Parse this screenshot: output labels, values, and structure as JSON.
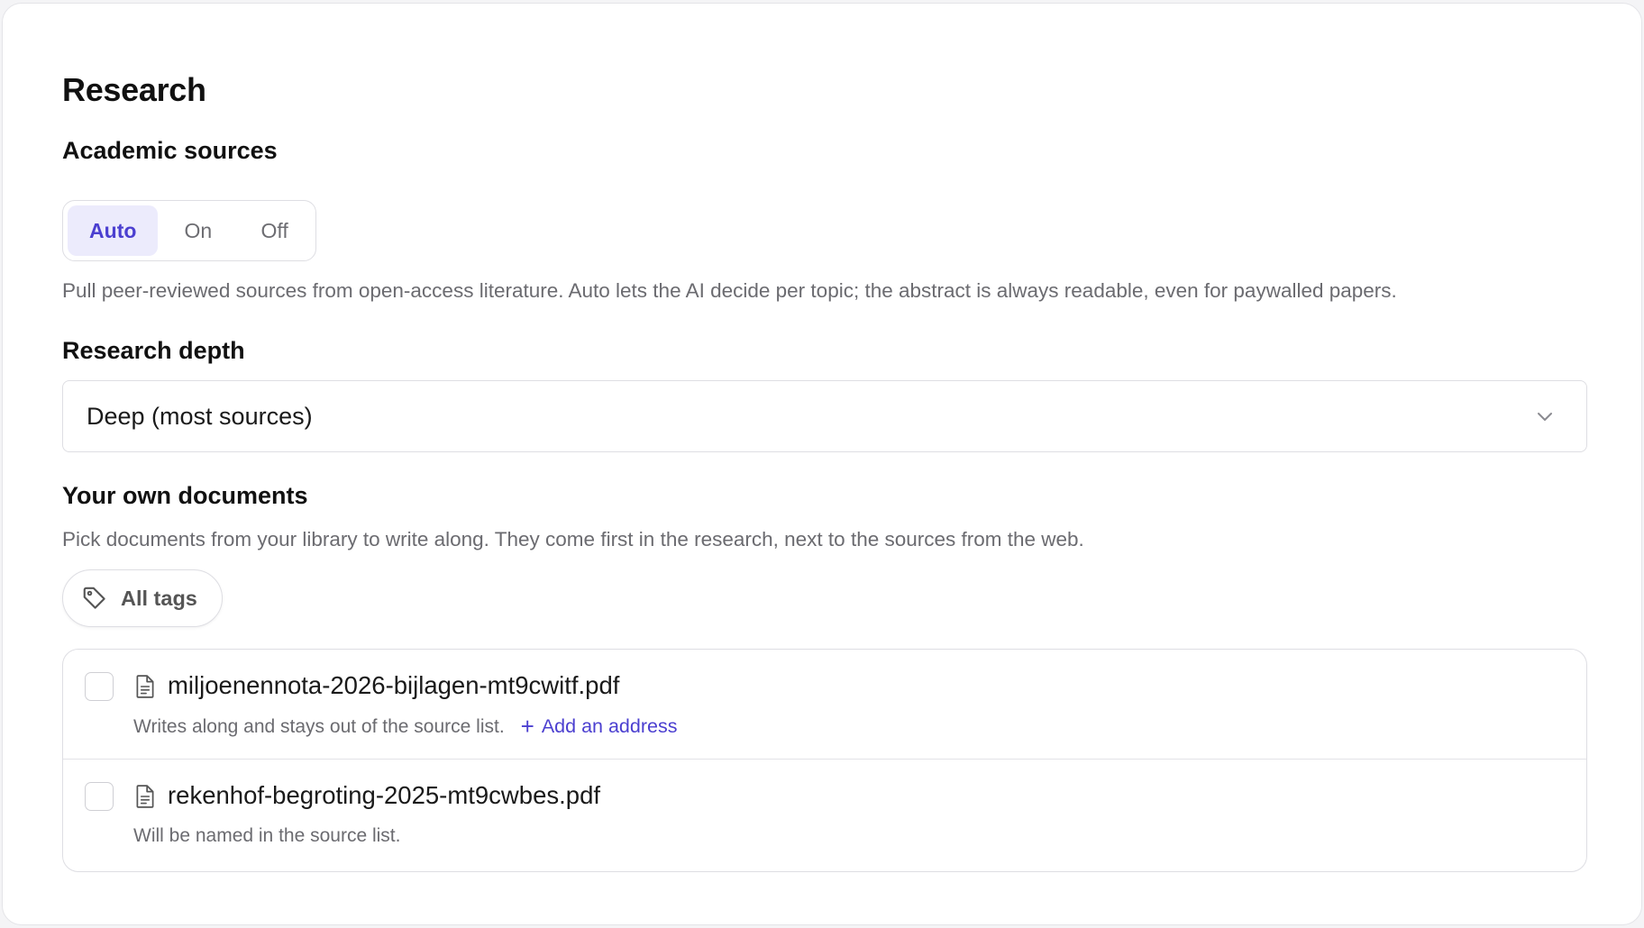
{
  "page": {
    "title": "Research"
  },
  "academic_sources": {
    "label": "Academic sources",
    "options": [
      "Auto",
      "On",
      "Off"
    ],
    "selected": "Auto",
    "help": "Pull peer-reviewed sources from open-access literature. Auto lets the AI decide per topic; the abstract is always readable, even for paywalled papers."
  },
  "research_depth": {
    "label": "Research depth",
    "value": "Deep (most sources)"
  },
  "own_documents": {
    "label": "Your own documents",
    "help": "Pick documents from your library to write along. They come first in the research, next to the sources from the web.",
    "tag_filter": "All tags",
    "documents": [
      {
        "name": "miljoenennota-2026-bijlagen-mt9cwitf.pdf",
        "note": "Writes along and stays out of the source list.",
        "action": "Add an address",
        "checked": false
      },
      {
        "name": "rekenhof-begroting-2025-mt9cwbes.pdf",
        "note": "Will be named in the source list.",
        "checked": false
      }
    ]
  },
  "colors": {
    "accent": "#4b3fd0",
    "accent_bg": "#ecebfc",
    "muted_text": "#6b6b70",
    "border": "#dedee3"
  }
}
